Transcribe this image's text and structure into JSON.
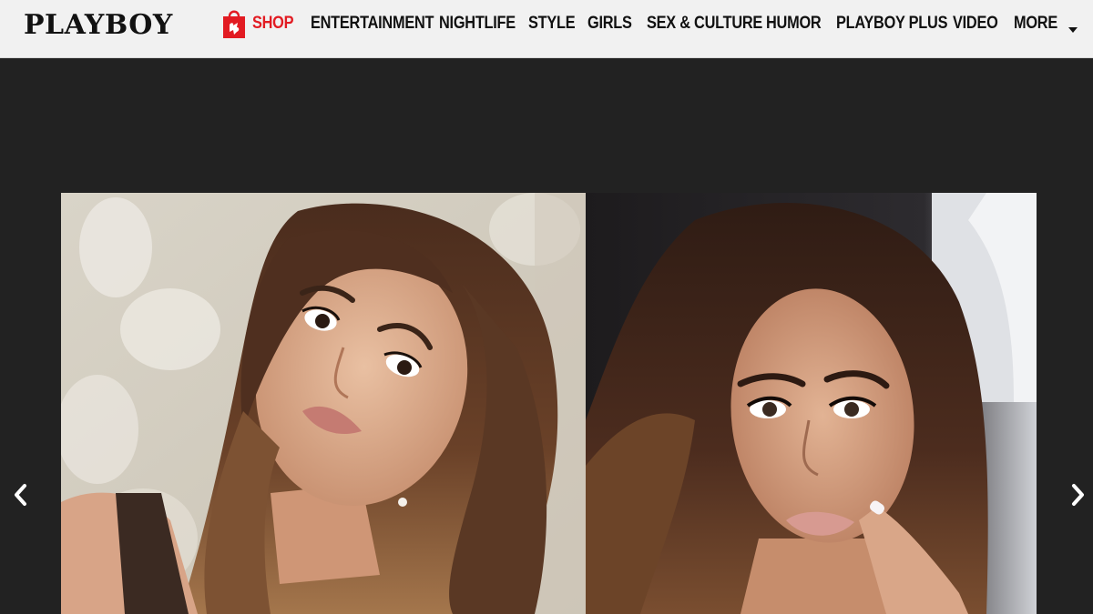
{
  "brand": {
    "logo_text": "PLAYBOY"
  },
  "nav": {
    "shop": {
      "label": "SHOP",
      "icon": "shopping-bag-icon",
      "color": "#e21b22"
    },
    "items": [
      {
        "label": "ENTERTAINMENT"
      },
      {
        "label": "NIGHTLIFE"
      },
      {
        "label": "STYLE"
      },
      {
        "label": "GIRLS"
      },
      {
        "label": "SEX & CULTURE"
      },
      {
        "label": "HUMOR"
      },
      {
        "label": "PLAYBOY PLUS"
      },
      {
        "label": "VIDEO"
      }
    ],
    "more": {
      "label": "MORE",
      "icon": "caret-down-icon"
    }
  },
  "gallery": {
    "prev_icon": "chevron-left-icon",
    "next_icon": "chevron-right-icon",
    "photos": [
      {
        "name": "left-photo",
        "subject": "woman with long brown hair, head tilted"
      },
      {
        "name": "right-photo",
        "subject": "woman with long brown hair, finger near lips"
      }
    ]
  },
  "colors": {
    "nav_bg": "#f1f1f1",
    "stage_bg": "#222222",
    "accent": "#e21b22",
    "text": "#111111"
  }
}
